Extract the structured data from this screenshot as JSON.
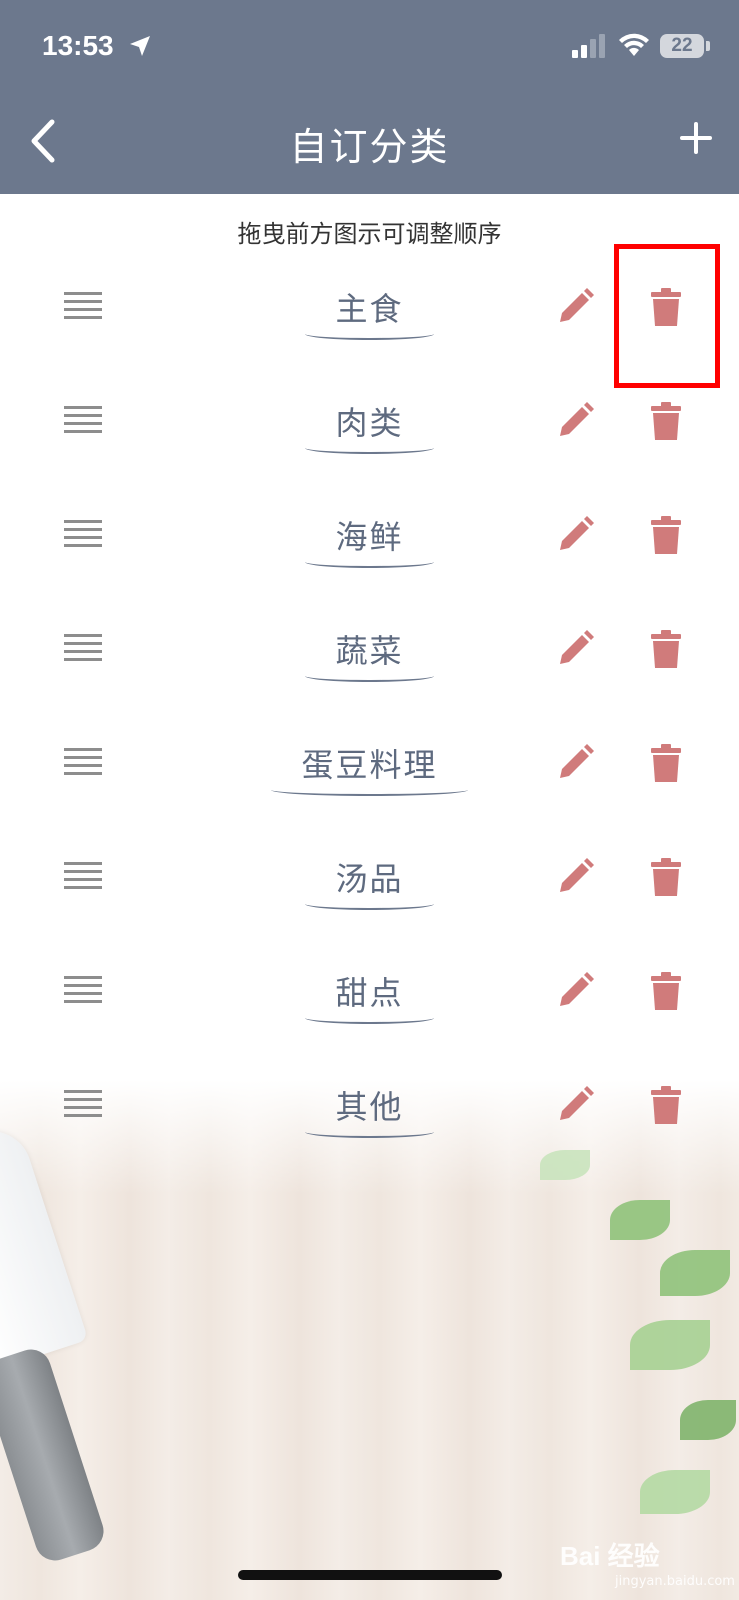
{
  "status_bar": {
    "time": "13:53",
    "battery": "22"
  },
  "header": {
    "title": "自订分类",
    "back_icon": "chevron-left-icon",
    "add_icon": "plus-icon",
    "background_color": "#6c788d"
  },
  "hint": "拖曳前方图示可调整顺序",
  "categories": [
    {
      "name": "主食"
    },
    {
      "name": "肉类"
    },
    {
      "name": "海鲜"
    },
    {
      "name": "蔬菜"
    },
    {
      "name": "蛋豆料理"
    },
    {
      "name": "汤品"
    },
    {
      "name": "甜点"
    },
    {
      "name": "其他"
    }
  ],
  "colors": {
    "accent_action": "#d07b7b",
    "highlight": "#ff0000",
    "text_category": "#5e6a7f"
  },
  "watermark": {
    "brand": "Bai 经验",
    "url": "jingyan.baidu.com"
  }
}
